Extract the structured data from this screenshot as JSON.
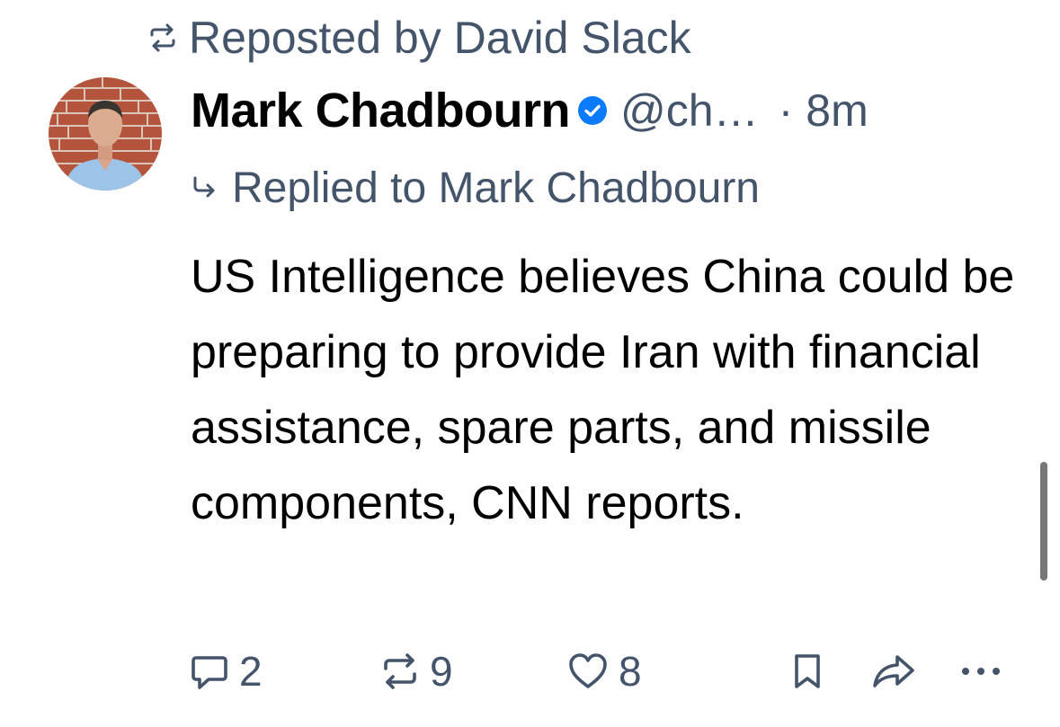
{
  "repost": {
    "icon": "repost-icon",
    "text": "Reposted by David Slack"
  },
  "author": {
    "avatar": "avatar",
    "name": "Mark Chadbourn",
    "verified_icon": "verified-badge-icon",
    "handle": "@ch…",
    "separator": "·",
    "time": "8m"
  },
  "reply": {
    "icon": "reply-arrow-icon",
    "text": "Replied to Mark Chadbourn"
  },
  "post": {
    "text": "US Intelligence believes China could be preparing to provide Iran with financial assistance, spare parts, and missile components, CNN reports."
  },
  "actions": {
    "reply_count": "2",
    "repost_count": "9",
    "like_count": "8",
    "icons": [
      "comment-icon",
      "repost-icon",
      "heart-icon",
      "bookmark-icon",
      "share-icon",
      "more-icon"
    ]
  },
  "colors": {
    "text": "#000000",
    "secondary": "#44546a",
    "verified": "#0a7aff",
    "scrollbar": "#777777"
  }
}
